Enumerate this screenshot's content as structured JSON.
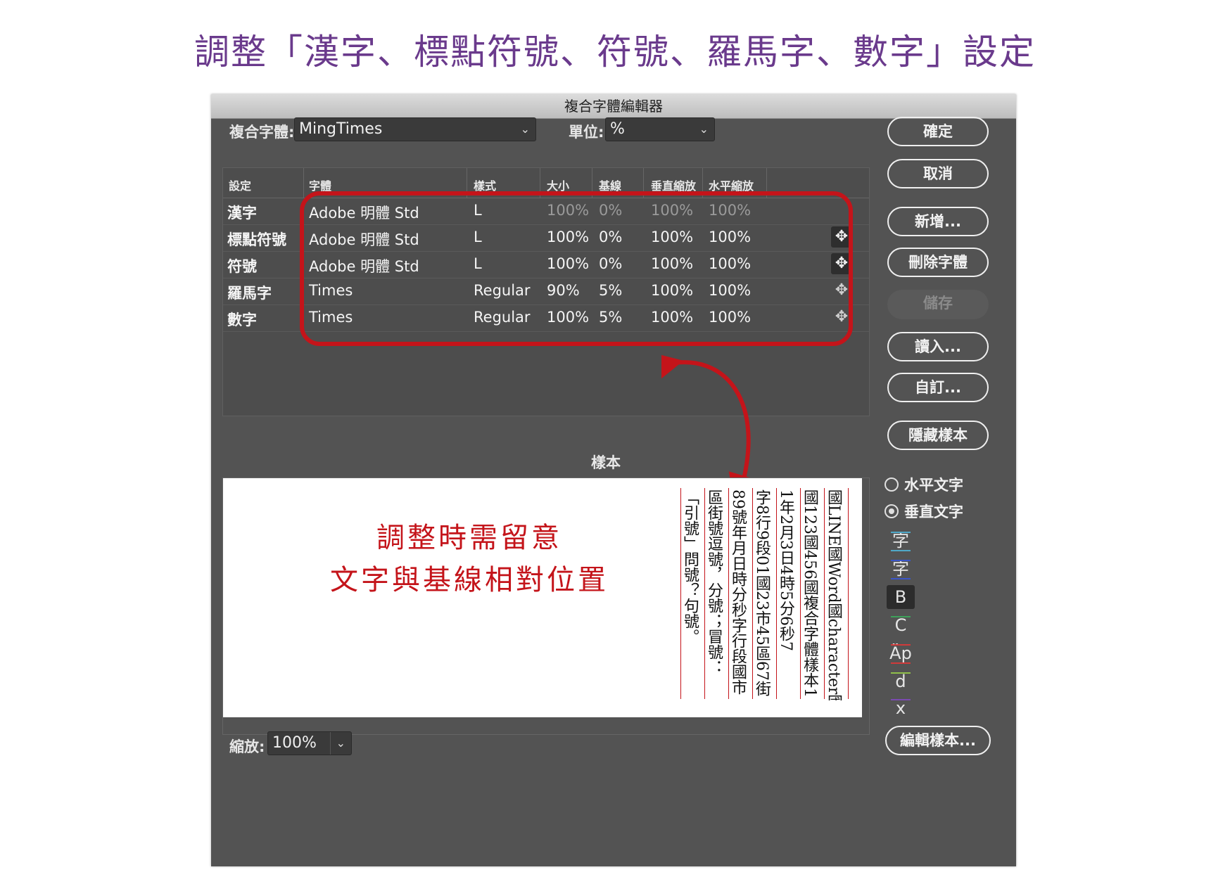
{
  "heading": "調整「漢字、標點符號、符號、羅馬字、數字」設定",
  "dialog": {
    "title": "複合字體編輯器",
    "composite_font_label": "複合字體:",
    "composite_font_value": "MingTimes",
    "unit_label": "單位:",
    "unit_value": "%",
    "columns": [
      "設定",
      "字體",
      "樣式",
      "大小",
      "基線",
      "垂直縮放",
      "水平縮放"
    ],
    "rows": [
      {
        "setting": "漢字",
        "font": "Adobe 明體 Std",
        "style": "L",
        "size": "100%",
        "baseline": "0%",
        "vscale": "100%",
        "hscale": "100%"
      },
      {
        "setting": "標點符號",
        "font": "Adobe 明體 Std",
        "style": "L",
        "size": "100%",
        "baseline": "0%",
        "vscale": "100%",
        "hscale": "100%"
      },
      {
        "setting": "符號",
        "font": "Adobe 明體 Std",
        "style": "L",
        "size": "100%",
        "baseline": "0%",
        "vscale": "100%",
        "hscale": "100%"
      },
      {
        "setting": "羅馬字",
        "font": "Times",
        "style": "Regular",
        "size": "90%",
        "baseline": "5%",
        "vscale": "100%",
        "hscale": "100%"
      },
      {
        "setting": "數字",
        "font": "Times",
        "style": "Regular",
        "size": "100%",
        "baseline": "5%",
        "vscale": "100%",
        "hscale": "100%"
      }
    ],
    "buttons": {
      "ok": "確定",
      "cancel": "取消",
      "new": "新增...",
      "delete_font": "刪除字體",
      "save": "儲存",
      "load": "讀入...",
      "custom": "自訂...",
      "hide_sample": "隱藏樣本",
      "edit_sample": "編輯樣本..."
    },
    "sample_label": "樣本",
    "sample_note": [
      "調整時需留意",
      "文字與基線相對位置"
    ],
    "sample_columns": [
      "國LINE國Word國character國type",
      "國123國456國複合字體樣本1",
      "1年2月3日4時5分6秒7",
      "字8行9段01國23市45區67街",
      "89號年月日時分秒字行段國市",
      "區街號逗號，分號；冒號：",
      "「引號」問號？句號。"
    ],
    "orientation": {
      "horizontal": "水平文字",
      "vertical": "垂直文字",
      "selected": "vertical"
    },
    "tools": [
      "字",
      "字",
      "B",
      "C",
      "Äp",
      "d",
      "x"
    ],
    "zoom_label": "縮放:",
    "zoom_value": "100%",
    "colors": {
      "accent_red": "#c4141a",
      "heading_purple": "#6a3a8c"
    }
  }
}
